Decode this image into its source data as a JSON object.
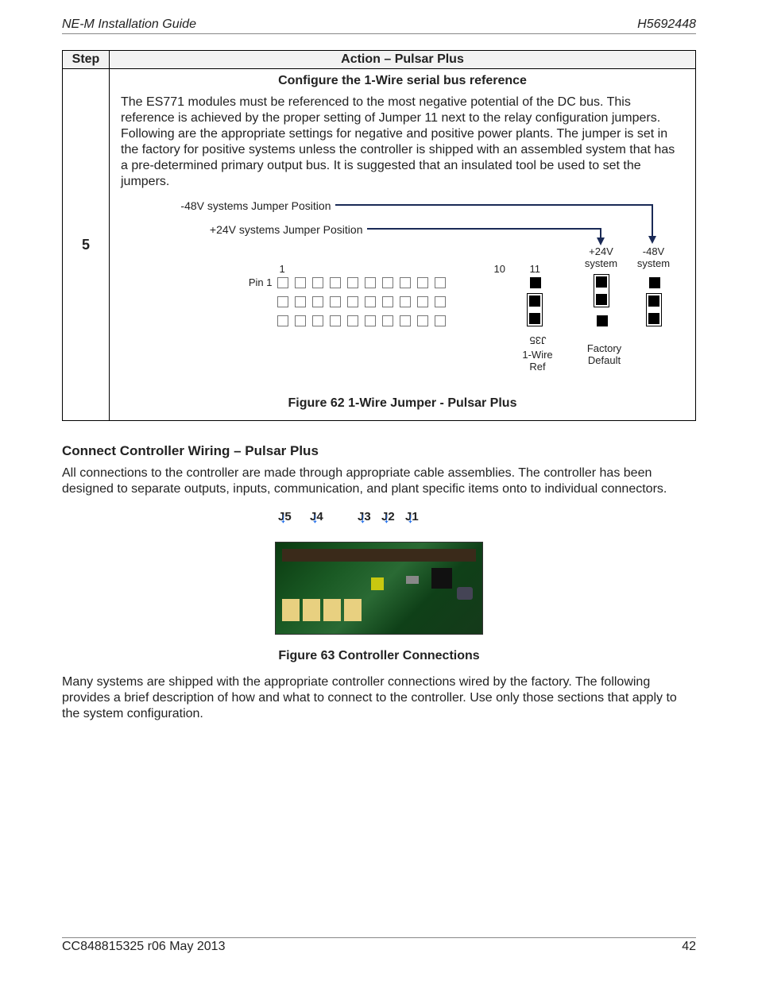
{
  "header": {
    "left": "NE-M Installation Guide",
    "right": "H5692448"
  },
  "table": {
    "cols": {
      "step": "Step",
      "action": "Action – Pulsar Plus"
    },
    "row": {
      "step": "5",
      "subhead": "Configure the 1-Wire serial bus reference",
      "body": "The ES771 modules must be referenced to the most negative potential of the DC bus. This reference is achieved by the proper setting of Jumper 11 next to the relay configuration jumpers. Following are the appropriate settings for negative and positive power plants. The jumper is set in the factory for positive systems unless the controller is shipped with an assembled system that has a pre-determined primary output bus. It is suggested that an insulated tool be used to set the jumpers.",
      "labels": {
        "neg48": "-48V systems Jumper Position",
        "pos24": "+24V systems Jumper Position",
        "pin1": "Pin 1",
        "n1": "1",
        "n10": "10",
        "n11": "11",
        "p24sys": "+24V\nsystem",
        "n48sys": "-48V\nsystem",
        "j35": "J35",
        "onewire": "1-Wire\nRef",
        "factory": "Factory\nDefault"
      },
      "caption": "Figure 62 1-Wire Jumper - Pulsar Plus"
    }
  },
  "section": {
    "title": "Connect Controller Wiring – Pulsar Plus",
    "p1": "All connections to the controller are made through appropriate cable assemblies. The controller has been designed to separate outputs, inputs, communication, and plant specific items onto to individual connectors.",
    "connectors": {
      "j5": "J5",
      "j4": "J4",
      "j3": "J3",
      "j2": "J2",
      "j1": "J1"
    },
    "caption": "Figure 63 Controller Connections",
    "p2": "Many systems are shipped with the appropriate controller connections wired by the factory. The following provides a brief description of how and what to connect to the controller. Use only those sections that apply to the system configuration."
  },
  "footer": {
    "left": "CC848815325  r06  May 2013",
    "right": "42"
  }
}
